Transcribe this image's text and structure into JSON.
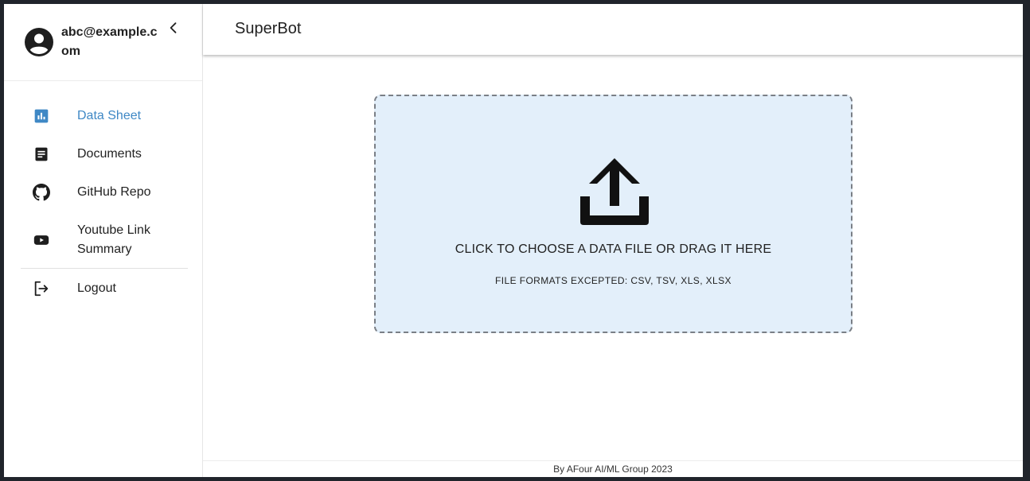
{
  "user": {
    "email": "abc@example.com"
  },
  "sidebar": {
    "items": [
      {
        "label": "Data Sheet",
        "icon": "bar-chart-icon",
        "active": true
      },
      {
        "label": "Documents",
        "icon": "document-icon"
      },
      {
        "label": "GitHub Repo",
        "icon": "github-icon"
      },
      {
        "label": "Youtube Link Summary",
        "icon": "youtube-icon"
      }
    ],
    "logout": {
      "label": "Logout",
      "icon": "logout-icon"
    }
  },
  "header": {
    "title": "SuperBot"
  },
  "dropzone": {
    "icon": "upload-icon",
    "title": "CLICK TO CHOOSE A DATA FILE OR DRAG IT HERE",
    "subtitle": "FILE FORMATS EXCEPTED: CSV, TSV, XLS, XLSX"
  },
  "footer": {
    "text": "By AFour AI/ML Group 2023"
  },
  "colors": {
    "accent": "#3f88c5",
    "dropzone_bg": "#e3effa",
    "text": "#222222"
  }
}
